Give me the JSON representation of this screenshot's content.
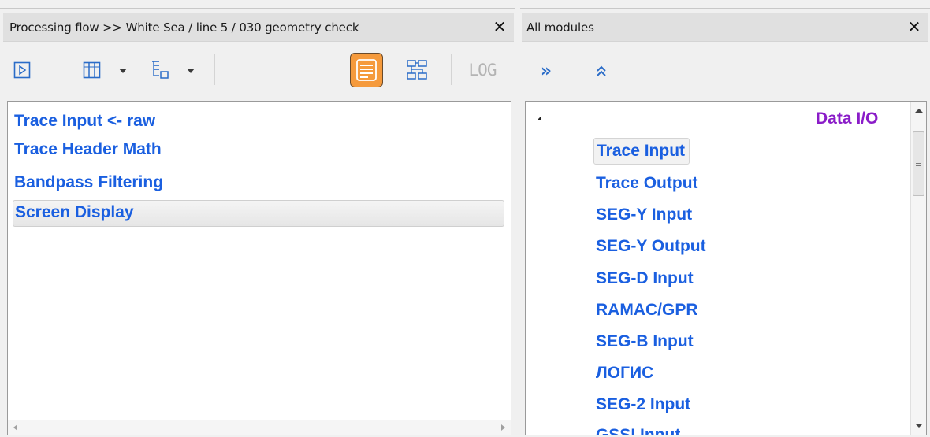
{
  "flow_panel": {
    "title": "Processing flow >> White Sea / line 5 / 030 geometry check",
    "close_glyph": "✕",
    "toolbar": {
      "run": "run-icon",
      "columns": "columns-icon",
      "tree": "tree-icon",
      "list_view": "list-view-icon",
      "diagram_view": "diagram-icon",
      "log_label": "LOG"
    },
    "items": [
      {
        "label": "Trace Input <- raw"
      },
      {
        "label": "Trace Header Math"
      },
      {
        "label": "Bandpass Filtering"
      },
      {
        "label": "Screen Display"
      }
    ]
  },
  "modules_panel": {
    "title": "All modules",
    "close_glyph": "✕",
    "toolbar": {
      "expand": "»",
      "collapse": "double-chevron-up-icon"
    },
    "group": {
      "label": "Data I/O"
    },
    "items": [
      {
        "label": "Trace Input"
      },
      {
        "label": "Trace Output"
      },
      {
        "label": "SEG-Y Input"
      },
      {
        "label": "SEG-Y Output"
      },
      {
        "label": "SEG-D Input"
      },
      {
        "label": "RAMAC/GPR"
      },
      {
        "label": "SEG-B Input"
      },
      {
        "label": "ЛОГИС"
      },
      {
        "label": "SEG-2 Input"
      },
      {
        "label": "GSSI Input"
      }
    ]
  },
  "colors": {
    "item_text": "#1a5fe0",
    "group_text": "#8a1cc8",
    "active_button": "#f59a3c"
  }
}
